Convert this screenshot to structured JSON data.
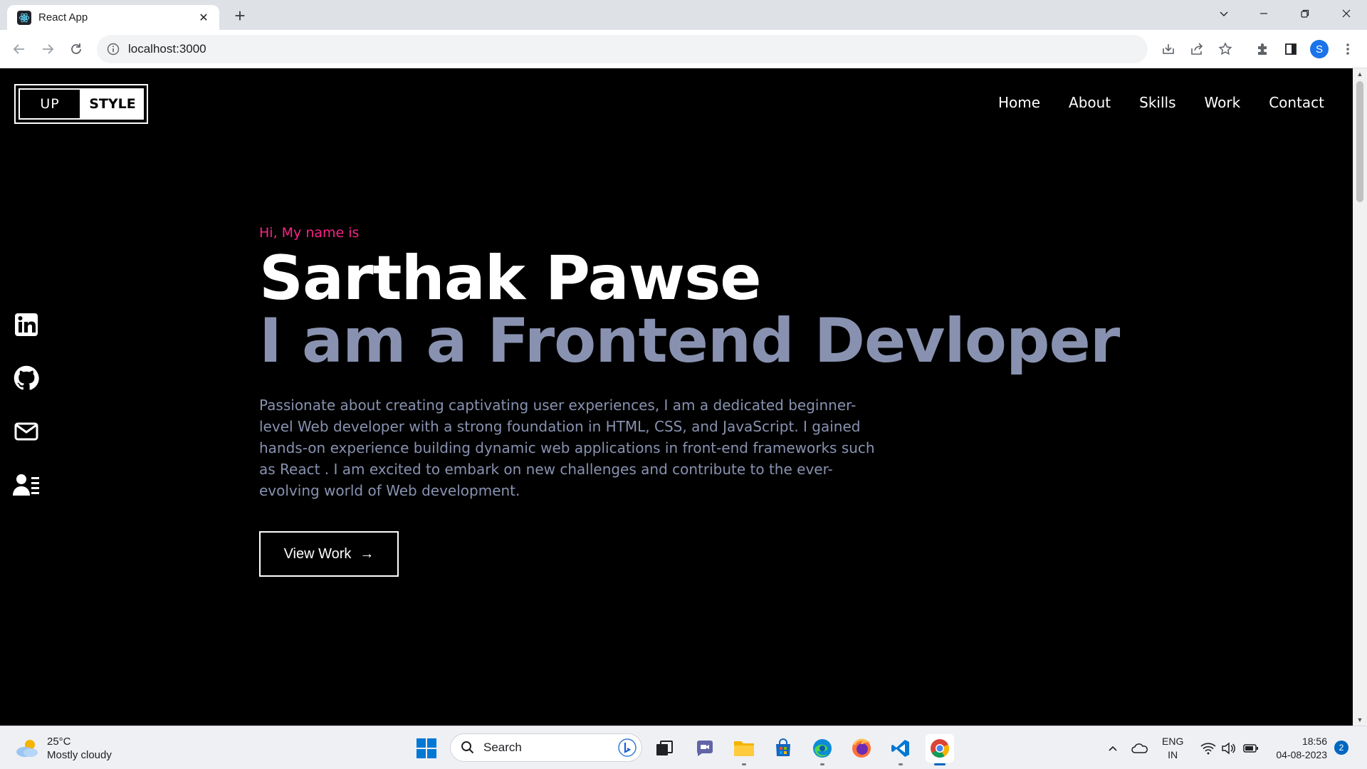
{
  "browser": {
    "tab_title": "React App",
    "tab_close": "✕",
    "new_tab": "+",
    "url": "localhost:3000",
    "profile_initial": "S"
  },
  "page": {
    "logo": {
      "left": "UP",
      "right": "STYLE"
    },
    "nav": [
      "Home",
      "About",
      "Skills",
      "Work",
      "Contact"
    ],
    "social": [
      "linkedin-icon",
      "github-icon",
      "mail-icon",
      "contact-card-icon"
    ],
    "hero": {
      "greeting": "Hi, My name is",
      "name": "Sarthak Pawse",
      "role": "I am a Frontend Devloper",
      "description": "Passionate about creating captivating user experiences, I am a dedicated beginner-level Web developer with a strong foundation in HTML, CSS, and JavaScript. I gained hands-on experience building dynamic web applications in front-end frameworks such as React . I am excited to embark on new challenges and contribute to the ever-evolving world of Web development.",
      "button_label": "View Work",
      "button_arrow": "→"
    },
    "colors": {
      "accent_pink": "#f72585",
      "slate": "#8892b0",
      "background": "#000000"
    }
  },
  "taskbar": {
    "weather": {
      "temp": "25°C",
      "condition": "Mostly cloudy"
    },
    "search_placeholder": "Search",
    "lang_top": "ENG",
    "lang_bottom": "IN",
    "time": "18:56",
    "date": "04-08-2023",
    "notification_count": "2"
  }
}
